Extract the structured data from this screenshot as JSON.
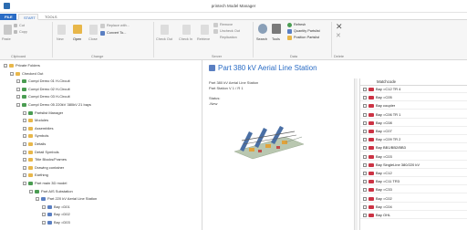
{
  "window": {
    "title": "printech Model Manager"
  },
  "tabs": [
    {
      "label": "FILE"
    },
    {
      "label": "START"
    },
    {
      "label": "TOOLS"
    }
  ],
  "ribbon": {
    "clipboard": {
      "label": "Clipboard",
      "cut": "Cut",
      "copy": "Copy",
      "paste": "Paste"
    },
    "change": {
      "label": "Change",
      "new": "New",
      "open": "Open",
      "close": "Close",
      "replace": "Replace with...",
      "convert": "Convert To..."
    },
    "server": {
      "label": "Server",
      "check_out": "Check Out",
      "check_in": "Check In",
      "retrieve": "Retrieve",
      "remove": "Remove",
      "uncheck": "Uncheck Out",
      "replication": "Replication"
    },
    "data": {
      "label": "Data",
      "search": "Search",
      "tools": "Tools",
      "refresh": "Refresh",
      "quantity": "Quantity Partslist",
      "position": "Position Partslist"
    },
    "delete": {
      "label": "Delete"
    }
  },
  "tree": {
    "items": [
      {
        "label": "Private Folders",
        "depth": 0,
        "icon": "folder"
      },
      {
        "label": "Checked Out",
        "depth": 1,
        "icon": "folder"
      },
      {
        "label": "Compl Demo 01 H-Circuit",
        "depth": 2,
        "icon": "project"
      },
      {
        "label": "Compl Demo 02 H-Circuit",
        "depth": 2,
        "icon": "project"
      },
      {
        "label": "Compl Demo 03 H-Circuit",
        "depth": 2,
        "icon": "project"
      },
      {
        "label": "Compl Demo 05 220kV 380kV 21 bays",
        "depth": 2,
        "icon": "project"
      },
      {
        "label": "Partslist Manager",
        "depth": 3,
        "icon": "project"
      },
      {
        "label": "Modules",
        "depth": 3,
        "icon": "folder"
      },
      {
        "label": "Assemblies",
        "depth": 3,
        "icon": "folder"
      },
      {
        "label": "Symbols",
        "depth": 3,
        "icon": "folder"
      },
      {
        "label": "Details",
        "depth": 3,
        "icon": "folder"
      },
      {
        "label": "Detail Symbols",
        "depth": 3,
        "icon": "folder"
      },
      {
        "label": "Title Blocks/Frames",
        "depth": 3,
        "icon": "folder"
      },
      {
        "label": "Drawing container",
        "depth": 3,
        "icon": "folder"
      },
      {
        "label": "Earthing",
        "depth": 3,
        "icon": "folder"
      },
      {
        "label": "Part main 3D model",
        "depth": 3,
        "icon": "project"
      },
      {
        "label": "Part AIS Substation",
        "depth": 4,
        "icon": "project"
      },
      {
        "label": "Part 220 kV Aerial Line Station",
        "depth": 5,
        "icon": "page"
      },
      {
        "label": "Bay =D01",
        "depth": 6,
        "icon": "page"
      },
      {
        "label": "Bay =D02",
        "depth": 6,
        "icon": "page"
      },
      {
        "label": "Bay =D03",
        "depth": 6,
        "icon": "page"
      }
    ]
  },
  "panel": {
    "title": "Part 380 kV Aerial Line Station",
    "info1": "Part 380 kV Aerial Line Station",
    "info2": "Part Station V 1 / R 1",
    "status_label": "Status:",
    "status_value": "-New"
  },
  "matchcode": {
    "header": "Matchcode",
    "rows": [
      "Bay =C12 TR 4",
      "Bay =C05",
      "Bay coupler",
      "Bay =C06  TR 1",
      "Bay =C08",
      "Bay =C07",
      "Bay =C09  TR 2",
      "Bay BB1/BB2/BB3",
      "Bay =C03",
      "Bay SingleLine 380/220 kV",
      "Bay =C12",
      "Bay =C11  TR3",
      "Bay =C33",
      "Bay =C02",
      "Bay =C04",
      "Bay OHL"
    ]
  }
}
